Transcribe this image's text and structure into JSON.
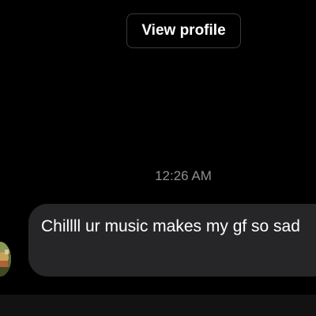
{
  "header": {
    "view_profile_label": "View profile"
  },
  "thread": {
    "timestamp": "12:26 AM",
    "messages": [
      {
        "sender": "other",
        "text": "Chillll ur music makes my gf so sad"
      }
    ]
  },
  "colors": {
    "background": "#000000",
    "bubble_background": "#262628",
    "timestamp_text": "#8e8e93",
    "button_border": "#3a3a3c"
  },
  "icons": {
    "avatar": "avatar-photo"
  }
}
